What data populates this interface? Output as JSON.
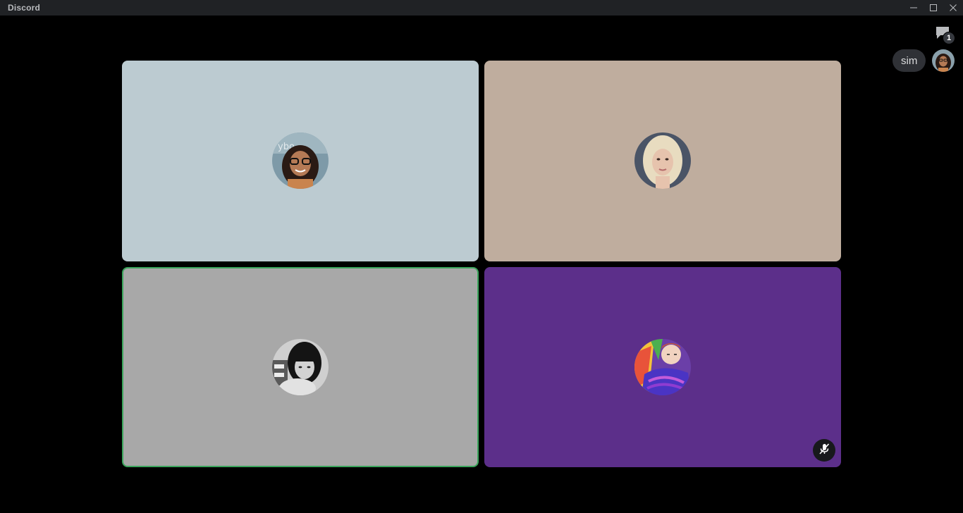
{
  "window": {
    "title": "Discord",
    "minimize_icon": "minimize-icon",
    "maximize_icon": "maximize-icon",
    "close_icon": "close-icon"
  },
  "overlay": {
    "chat_icon": "chat-bubble-icon",
    "chat_badge_count": "1",
    "user_pill_label": "sim",
    "self_avatar_icon": "avatar"
  },
  "participants": [
    {
      "avatar_icon": "avatar",
      "tile_color": "#bccbd1",
      "speaking": false,
      "muted": false
    },
    {
      "avatar_icon": "avatar",
      "tile_color": "#bfad9e",
      "speaking": false,
      "muted": false
    },
    {
      "avatar_icon": "avatar",
      "tile_color": "#a8a8a8",
      "speaking": true,
      "muted": false
    },
    {
      "avatar_icon": "avatar",
      "tile_color": "#5c2f8a",
      "speaking": false,
      "muted": true,
      "mute_icon": "microphone-muted-icon"
    }
  ],
  "colors": {
    "speaking_border": "#3ba55c",
    "titlebar_bg": "#202225",
    "stage_bg": "#000000"
  }
}
